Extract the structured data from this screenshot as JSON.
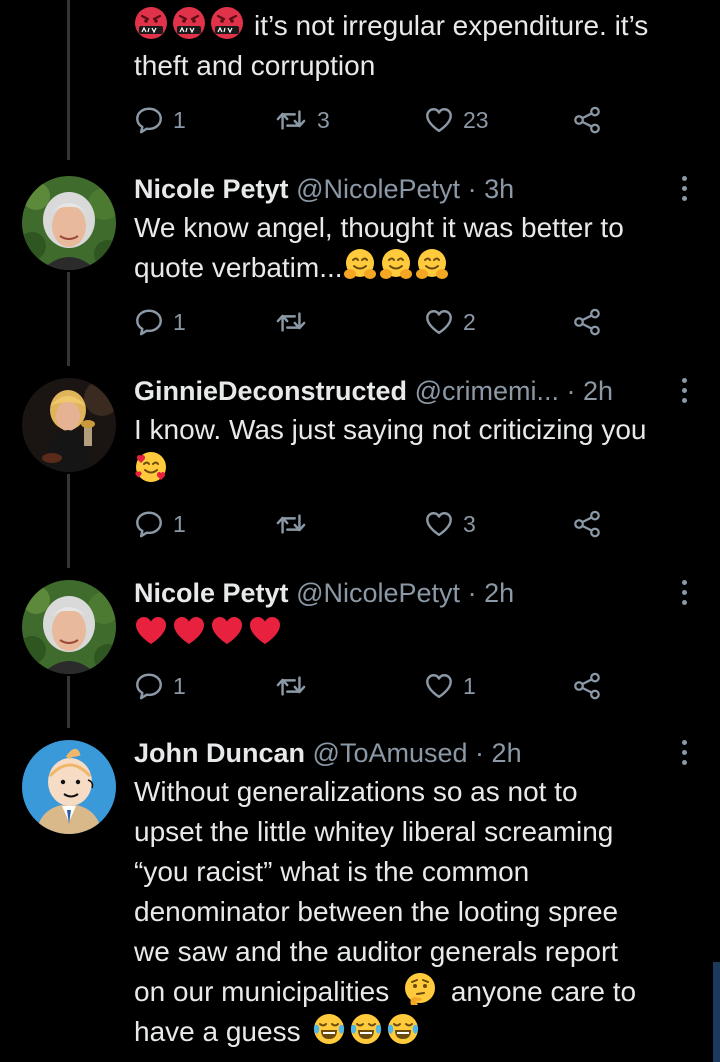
{
  "colors": {
    "background": "#000000",
    "text": "#e7e9ea",
    "muted": "#8b98a5",
    "thread_line": "#333639",
    "heart_emoji": "#e8213e"
  },
  "tweets": [
    {
      "id": "tweet-top",
      "text_lines": [
        "it’s not irregular expenditure. it’s",
        "theft and corruption"
      ],
      "lead_emojis": [
        "cursing-face-emoji",
        "cursing-face-emoji",
        "cursing-face-emoji"
      ],
      "stats": {
        "replies": "1",
        "retweets": "3",
        "likes": "23"
      }
    },
    {
      "id": "tweet-nicole-1",
      "display_name": "Nicole Petyt",
      "handle": "@NicolePetyt",
      "separator": "·",
      "time": "3h",
      "text_lines": [
        "We know angel, thought it was better to",
        "quote verbatim..."
      ],
      "trailing_emojis": [
        "hugging-face-emoji",
        "hugging-face-emoji",
        "hugging-face-emoji"
      ],
      "stats": {
        "replies": "1",
        "retweets": "",
        "likes": "2"
      }
    },
    {
      "id": "tweet-ginnie",
      "display_name": "GinnieDeconstructed",
      "handle": "@crimemi...",
      "separator": "·",
      "time": "2h",
      "text_lines": [
        "I know. Was just saying not criticizing you"
      ],
      "trailing_emojis": [
        "smiling-face-with-hearts-emoji"
      ],
      "stats": {
        "replies": "1",
        "retweets": "",
        "likes": "3"
      }
    },
    {
      "id": "tweet-nicole-2",
      "display_name": "Nicole Petyt",
      "handle": "@NicolePetyt",
      "separator": "·",
      "time": "2h",
      "text_lines": [],
      "trailing_emojis": [
        "red-heart-emoji",
        "red-heart-emoji",
        "red-heart-emoji",
        "red-heart-emoji"
      ],
      "stats": {
        "replies": "1",
        "retweets": "",
        "likes": "1"
      }
    },
    {
      "id": "tweet-john",
      "display_name": "John Duncan",
      "handle": "@ToAmused",
      "separator": "·",
      "time": "2h",
      "text_lines": [
        "Without generalizations so as not to",
        "upset the little whitey liberal screaming",
        "“you racist” what is the common",
        "denominator between the looting spree",
        "we saw and the auditor generals report",
        "on our municipalities",
        "anyone care to",
        "have a guess"
      ],
      "inline_emojis": [
        "thinking-face-emoji"
      ],
      "trailing_emojis": [
        "tears-of-joy-emoji",
        "tears-of-joy-emoji",
        "tears-of-joy-emoji"
      ]
    }
  ]
}
